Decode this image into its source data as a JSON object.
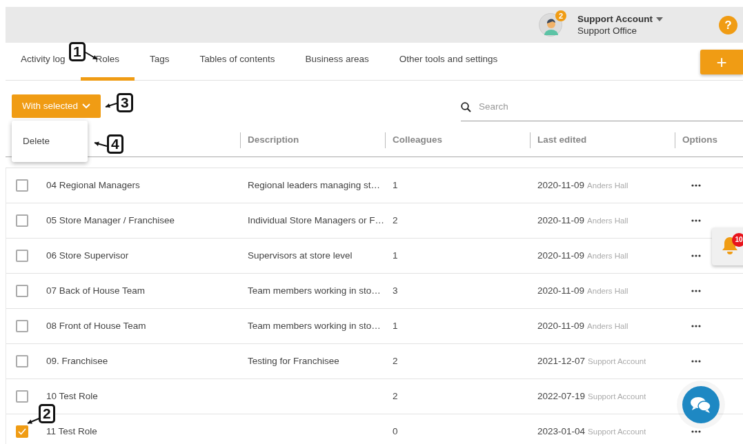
{
  "header": {
    "avatar_badge": "2",
    "account_name": "Support Account",
    "account_office": "Support Office",
    "help_label": "?"
  },
  "tabs": [
    {
      "label": "Activity log",
      "selected": false
    },
    {
      "label": "Roles",
      "selected": true
    },
    {
      "label": "Tags",
      "selected": false
    },
    {
      "label": "Tables of contents",
      "selected": false
    },
    {
      "label": "Business areas",
      "selected": false
    },
    {
      "label": "Other tools and settings",
      "selected": false
    }
  ],
  "add_button": {
    "label": "+"
  },
  "toolbar": {
    "bulk_button": "With selected",
    "search": {
      "placeholder": "Search"
    }
  },
  "dropdown": {
    "expanded": true,
    "items": [
      "Delete"
    ]
  },
  "table": {
    "columns": [
      "Description",
      "Colleagues",
      "Last edited",
      "Options"
    ],
    "rows": [
      {
        "checked": false,
        "name": "04 Regional Managers",
        "description": "Regional leaders managing st…",
        "colleagues": "1",
        "date": "2020-11-09",
        "editor": "Anders Hall",
        "menu": true
      },
      {
        "checked": false,
        "name": "05 Store Manager / Franchisee",
        "description": "Individual Store Managers or F…",
        "colleagues": "2",
        "date": "2020-11-09",
        "editor": "Anders Hall",
        "menu": true
      },
      {
        "checked": false,
        "name": "06 Store Supervisor",
        "description": "Supervisors at store level",
        "colleagues": "1",
        "date": "2020-11-09",
        "editor": "Anders Hall",
        "menu": true
      },
      {
        "checked": false,
        "name": "07 Back of House Team",
        "description": "Team members working in sto…",
        "colleagues": "3",
        "date": "2020-11-09",
        "editor": "Anders Hall",
        "menu": true
      },
      {
        "checked": false,
        "name": "08 Front of House Team",
        "description": "Team members working in sto…",
        "colleagues": "1",
        "date": "2020-11-09",
        "editor": "Anders Hall",
        "menu": true
      },
      {
        "checked": false,
        "name": "09. Franchisee",
        "description": "Testing for Franchisee",
        "colleagues": "2",
        "date": "2021-12-07",
        "editor": "Support Account",
        "menu": true
      },
      {
        "checked": false,
        "name": "10 Test Role",
        "description": "",
        "colleagues": "2",
        "date": "2022-07-19",
        "editor": "Support Account",
        "menu": false
      },
      {
        "checked": true,
        "name": "11 Test Role",
        "description": "",
        "colleagues": "0",
        "date": "2023-01-04",
        "editor": "Support Account",
        "menu": true
      }
    ]
  },
  "notifications": {
    "badge": "10"
  },
  "callouts": [
    "1",
    "2",
    "3",
    "4"
  ]
}
